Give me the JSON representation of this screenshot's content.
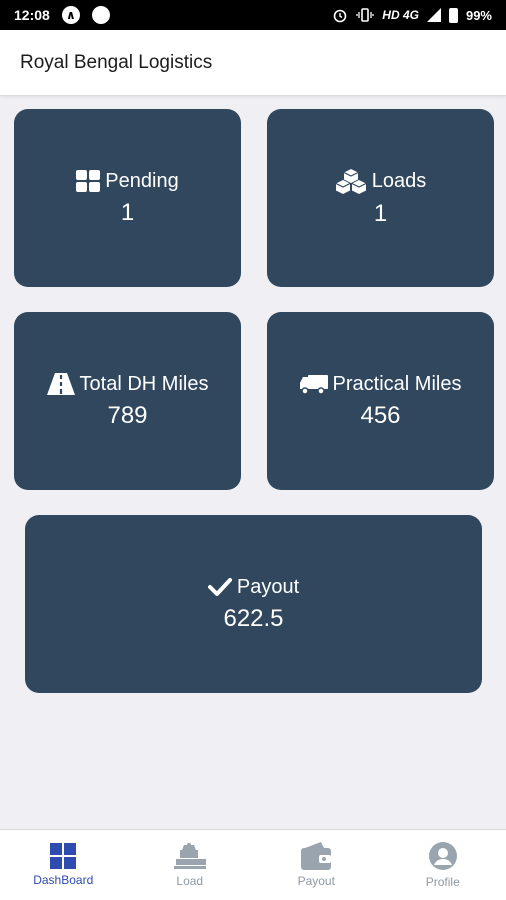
{
  "status_bar": {
    "time": "12:08",
    "network": "HD 4G",
    "battery": "99%"
  },
  "header": {
    "title": "Royal Bengal Logistics"
  },
  "cards": {
    "pending": {
      "label": "Pending",
      "value": "1",
      "icon": "grid-icon"
    },
    "loads": {
      "label": "Loads",
      "value": "1",
      "icon": "boxes-icon"
    },
    "dh_miles": {
      "label": "Total DH Miles",
      "value": "789",
      "icon": "road-icon"
    },
    "practical_miles": {
      "label": "Practical Miles",
      "value": "456",
      "icon": "truck-icon"
    },
    "payout": {
      "label": "Payout",
      "value": "622.5",
      "icon": "check-icon"
    }
  },
  "nav": {
    "dashboard": "DashBoard",
    "load": "Load",
    "payout": "Payout",
    "profile": "Profile"
  },
  "colors": {
    "card": "#30475e",
    "active_nav": "#2e4bb0",
    "inactive_nav": "#8e99a4"
  }
}
